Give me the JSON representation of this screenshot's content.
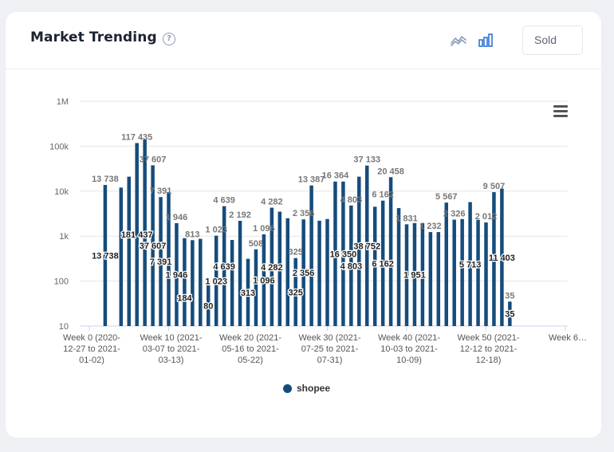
{
  "header": {
    "title": "Market Trending",
    "help_glyph": "?",
    "metric_select": "Sold"
  },
  "icons": {
    "help": "question-circle-icon",
    "line_view": "line-chart-icon",
    "bar_view": "bar-chart-icon",
    "menu": "hamburger-menu-icon"
  },
  "colors": {
    "bar": "#154c7c",
    "active_icon": "#2f73d6",
    "inactive_icon": "#8a9ab8"
  },
  "chart_data": {
    "type": "bar",
    "y_scale": "log",
    "ylim": [
      10,
      1000000
    ],
    "y_ticks": [
      {
        "value": 10,
        "label": "10"
      },
      {
        "value": 100,
        "label": "100"
      },
      {
        "value": 1000,
        "label": "1k"
      },
      {
        "value": 10000,
        "label": "10k"
      },
      {
        "value": 100000,
        "label": "100k"
      },
      {
        "value": 1000000,
        "label": "1M"
      }
    ],
    "x_ticks": [
      {
        "week": 0,
        "lines": [
          "Week 0 (2020-",
          "12-27 to 2021-",
          "01-02)"
        ]
      },
      {
        "week": 10,
        "lines": [
          "Week 10 (2021-",
          "03-07 to 2021-",
          "03-13)"
        ]
      },
      {
        "week": 20,
        "lines": [
          "Week 20 (2021-",
          "05-16 to 2021-",
          "05-22)"
        ]
      },
      {
        "week": 30,
        "lines": [
          "Week 30 (2021-",
          "07-25 to 2021-",
          "07-31)"
        ]
      },
      {
        "week": 40,
        "lines": [
          "Week 40 (2021-",
          "10-03 to 2021-",
          "10-09)"
        ]
      },
      {
        "week": 50,
        "lines": [
          "Week 50 (2021-",
          "12-12 to 2021-",
          "12-18)"
        ]
      },
      {
        "week": 60,
        "lines": [
          "Week 6…"
        ]
      }
    ],
    "series": [
      {
        "name": "shopee",
        "values": [
          {
            "week": 2,
            "value": 13738
          },
          {
            "week": 4,
            "value": 12000
          },
          {
            "week": 5,
            "value": 21000
          },
          {
            "week": 6,
            "value": 117435
          },
          {
            "week": 7,
            "value": 140000
          },
          {
            "week": 8,
            "value": 37607
          },
          {
            "week": 9,
            "value": 7391
          },
          {
            "week": 10,
            "value": 9500
          },
          {
            "week": 11,
            "value": 1946
          },
          {
            "week": 12,
            "value": 900
          },
          {
            "week": 13,
            "value": 813
          },
          {
            "week": 14,
            "value": 870
          },
          {
            "week": 15,
            "value": 80
          },
          {
            "week": 16,
            "value": 1023
          },
          {
            "week": 17,
            "value": 4639
          },
          {
            "week": 18,
            "value": 820
          },
          {
            "week": 19,
            "value": 2192
          },
          {
            "week": 20,
            "value": 313
          },
          {
            "week": 21,
            "value": 508
          },
          {
            "week": 22,
            "value": 1096
          },
          {
            "week": 23,
            "value": 4282
          },
          {
            "week": 24,
            "value": 3500
          },
          {
            "week": 25,
            "value": 2500
          },
          {
            "week": 26,
            "value": 325
          },
          {
            "week": 27,
            "value": 2356
          },
          {
            "week": 28,
            "value": 13387
          },
          {
            "week": 29,
            "value": 2200
          },
          {
            "week": 30,
            "value": 2400
          },
          {
            "week": 31,
            "value": 16364
          },
          {
            "week": 32,
            "value": 16350
          },
          {
            "week": 33,
            "value": 4803
          },
          {
            "week": 34,
            "value": 21000
          },
          {
            "week": 35,
            "value": 37133
          },
          {
            "week": 36,
            "value": 4500
          },
          {
            "week": 37,
            "value": 6162
          },
          {
            "week": 38,
            "value": 20458
          },
          {
            "week": 39,
            "value": 4200
          },
          {
            "week": 40,
            "value": 1831
          },
          {
            "week": 41,
            "value": 1951
          },
          {
            "week": 42,
            "value": 1951
          },
          {
            "week": 43,
            "value": 1232
          },
          {
            "week": 44,
            "value": 1232
          },
          {
            "week": 45,
            "value": 5567
          },
          {
            "week": 46,
            "value": 2326
          },
          {
            "week": 47,
            "value": 2400
          },
          {
            "week": 48,
            "value": 5713
          },
          {
            "week": 49,
            "value": 2300
          },
          {
            "week": 50,
            "value": 2012
          },
          {
            "week": 51,
            "value": 9507
          },
          {
            "week": 52,
            "value": 11403
          },
          {
            "week": 53,
            "value": 35
          }
        ]
      }
    ],
    "data_labels": [
      {
        "week": 2,
        "value": 13738,
        "text": "13 738",
        "pos": "top"
      },
      {
        "week": 2,
        "value": 13738,
        "text": "13 738",
        "pos": "in"
      },
      {
        "week": 6,
        "value": 117435,
        "text": "117 435",
        "pos": "top"
      },
      {
        "week": 6,
        "value": 117435,
        "text": "181 437",
        "pos": "in"
      },
      {
        "week": 8,
        "value": 37607,
        "text": "37 607",
        "pos": "top"
      },
      {
        "week": 8,
        "value": 37607,
        "text": "37 607",
        "pos": "in"
      },
      {
        "week": 9,
        "value": 7391,
        "text": "7 391",
        "pos": "top"
      },
      {
        "week": 9,
        "value": 7391,
        "text": "7 391",
        "pos": "in"
      },
      {
        "week": 11,
        "value": 1946,
        "text": "1 946",
        "pos": "top"
      },
      {
        "week": 11,
        "value": 1946,
        "text": "1 946",
        "pos": "in"
      },
      {
        "week": 12,
        "value": 184,
        "text": "184",
        "pos": "in"
      },
      {
        "week": 13,
        "value": 813,
        "text": "813",
        "pos": "top"
      },
      {
        "week": 15,
        "value": 80,
        "text": "80",
        "pos": "in"
      },
      {
        "week": 16,
        "value": 1023,
        "text": "1 023",
        "pos": "top"
      },
      {
        "week": 16,
        "value": 1023,
        "text": "1 023",
        "pos": "in"
      },
      {
        "week": 17,
        "value": 4639,
        "text": "4 639",
        "pos": "top"
      },
      {
        "week": 17,
        "value": 4639,
        "text": "4 639",
        "pos": "in"
      },
      {
        "week": 19,
        "value": 2192,
        "text": "2 192",
        "pos": "top"
      },
      {
        "week": 20,
        "value": 313,
        "text": "313",
        "pos": "in"
      },
      {
        "week": 21,
        "value": 508,
        "text": "508",
        "pos": "top"
      },
      {
        "week": 22,
        "value": 1096,
        "text": "1 096",
        "pos": "top"
      },
      {
        "week": 22,
        "value": 1096,
        "text": "1 096",
        "pos": "in"
      },
      {
        "week": 23,
        "value": 4282,
        "text": "4 282",
        "pos": "top"
      },
      {
        "week": 23,
        "value": 4282,
        "text": "4 282",
        "pos": "in"
      },
      {
        "week": 26,
        "value": 325,
        "text": "325",
        "pos": "top"
      },
      {
        "week": 26,
        "value": 325,
        "text": "325",
        "pos": "in"
      },
      {
        "week": 27,
        "value": 2356,
        "text": "2 356",
        "pos": "top"
      },
      {
        "week": 27,
        "value": 2356,
        "text": "2 356",
        "pos": "in"
      },
      {
        "week": 28,
        "value": 13387,
        "text": "13 387",
        "pos": "top"
      },
      {
        "week": 31,
        "value": 16364,
        "text": "16 364",
        "pos": "top"
      },
      {
        "week": 32,
        "value": 16350,
        "text": "16 350",
        "pos": "in"
      },
      {
        "week": 33,
        "value": 4803,
        "text": "4 803",
        "pos": "top"
      },
      {
        "week": 33,
        "value": 4803,
        "text": "4 803",
        "pos": "in"
      },
      {
        "week": 35,
        "value": 37133,
        "text": "37 133",
        "pos": "top"
      },
      {
        "week": 35,
        "value": 37133,
        "text": "38 752",
        "pos": "in"
      },
      {
        "week": 37,
        "value": 6162,
        "text": "6 162",
        "pos": "top"
      },
      {
        "week": 37,
        "value": 6162,
        "text": "6 162",
        "pos": "in"
      },
      {
        "week": 38,
        "value": 20458,
        "text": "20 458",
        "pos": "top"
      },
      {
        "week": 40,
        "value": 1831,
        "text": "1 831",
        "pos": "top"
      },
      {
        "week": 41,
        "value": 1951,
        "text": "1 951",
        "pos": "in"
      },
      {
        "week": 43,
        "value": 1232,
        "text": "1 232",
        "pos": "top"
      },
      {
        "week": 45,
        "value": 5567,
        "text": "5 567",
        "pos": "top"
      },
      {
        "week": 46,
        "value": 2326,
        "text": "2 326",
        "pos": "top"
      },
      {
        "week": 48,
        "value": 5713,
        "text": "5 713",
        "pos": "in"
      },
      {
        "week": 50,
        "value": 2012,
        "text": "2 012",
        "pos": "top"
      },
      {
        "week": 51,
        "value": 9507,
        "text": "9 507",
        "pos": "top"
      },
      {
        "week": 52,
        "value": 11403,
        "text": "11 403",
        "pos": "in"
      },
      {
        "week": 53,
        "value": 35,
        "text": "35",
        "pos": "top"
      },
      {
        "week": 53,
        "value": 35,
        "text": "35",
        "pos": "in"
      }
    ],
    "grid": true,
    "legend": "bottom-center"
  }
}
